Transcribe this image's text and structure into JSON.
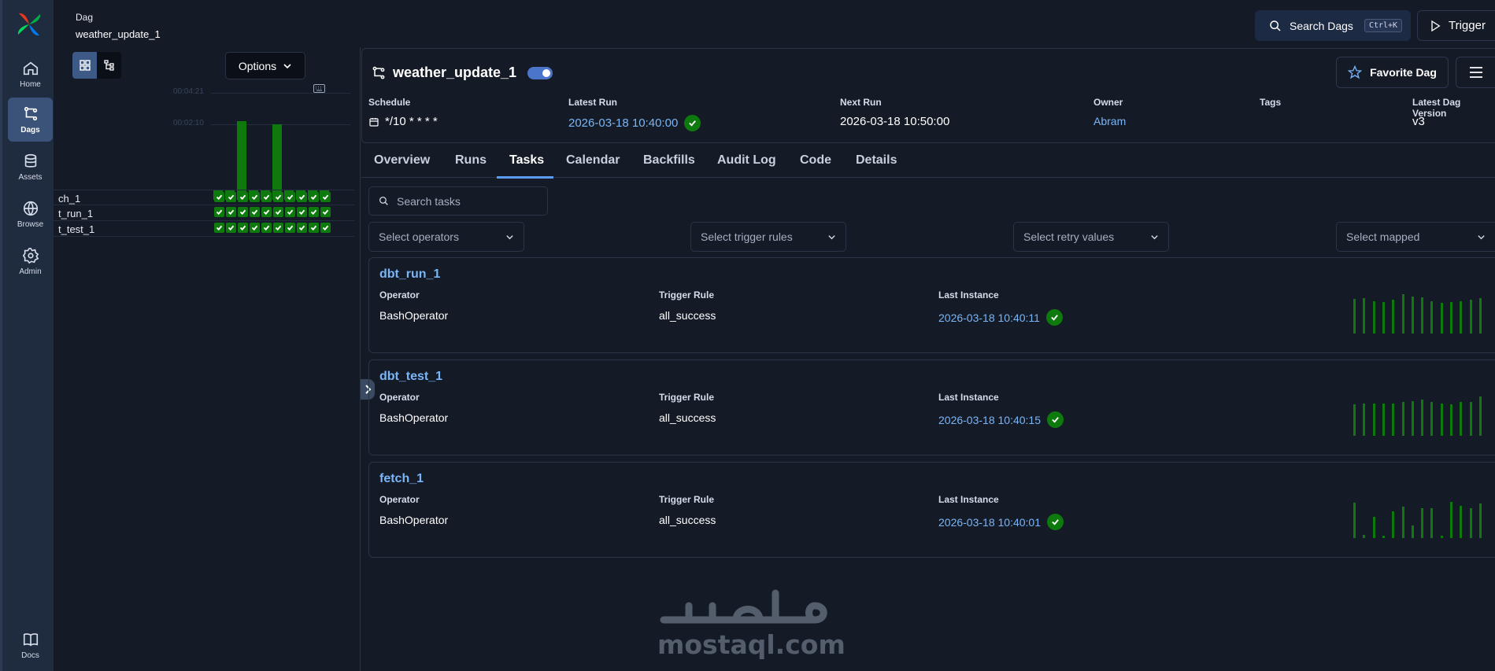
{
  "nav": {
    "items": [
      {
        "label": "Home",
        "icon": "home-icon"
      },
      {
        "label": "Dags",
        "icon": "dags-icon",
        "active": true
      },
      {
        "label": "Assets",
        "icon": "assets-icon"
      },
      {
        "label": "Browse",
        "icon": "browse-icon"
      },
      {
        "label": "Admin",
        "icon": "admin-icon"
      },
      {
        "label": "Docs",
        "icon": "docs-icon"
      }
    ]
  },
  "header": {
    "crumb_label": "Dag",
    "crumb_value": "weather_update_1",
    "search_label": "Search Dags",
    "search_shortcut": "Ctrl+K",
    "trigger_label": "Trigger"
  },
  "grid": {
    "options_label": "Options",
    "duration_ticks": [
      "00:04:21",
      "00:02:10"
    ],
    "run_durations_fraction": [
      0.12,
      0.12,
      1.0,
      0.12,
      0.12,
      0.96,
      0.12,
      0.12,
      0.12,
      0.12
    ],
    "tasks": [
      "fetch_1",
      "dbt_run_1",
      "dbt_test_1"
    ],
    "task_names_visible": [
      "ch_1",
      "t_run_1",
      "t_test_1"
    ],
    "runs_per_task": 10,
    "state": "success"
  },
  "dag": {
    "title": "weather_update_1",
    "paused": false,
    "favorite_label": "Favorite Dag",
    "meta": {
      "schedule_label": "Schedule",
      "schedule_value": "*/10 * * * *",
      "latest_run_label": "Latest Run",
      "latest_run_value": "2026-03-18 10:40:00",
      "next_run_label": "Next Run",
      "next_run_value": "2026-03-18 10:50:00",
      "owner_label": "Owner",
      "owner_value": "Abram",
      "tags_label": "Tags",
      "version_label": "Latest Dag Version",
      "version_value": "v3"
    }
  },
  "tabs": [
    "Overview",
    "Runs",
    "Tasks",
    "Calendar",
    "Backfills",
    "Audit Log",
    "Code",
    "Details"
  ],
  "active_tab": "Tasks",
  "filters": {
    "search_placeholder": "Search tasks",
    "operators": "Select operators",
    "trigger_rules": "Select trigger rules",
    "retry_values": "Select retry values",
    "mapped": "Select mapped"
  },
  "cards_labels": {
    "operator": "Operator",
    "trigger_rule": "Trigger Rule",
    "last_instance": "Last Instance"
  },
  "cards": [
    {
      "name": "dbt_run_1",
      "operator": "BashOperator",
      "trigger_rule": "all_success",
      "last_instance": "2026-03-18 10:40:11",
      "bars": [
        0.78,
        0.8,
        0.74,
        0.72,
        0.76,
        0.9,
        0.84,
        0.82,
        0.74,
        0.7,
        0.72,
        0.74,
        0.76,
        0.8
      ]
    },
    {
      "name": "dbt_test_1",
      "operator": "BashOperator",
      "trigger_rule": "all_success",
      "last_instance": "2026-03-18 10:40:15",
      "bars": [
        0.72,
        0.74,
        0.74,
        0.74,
        0.74,
        0.76,
        0.78,
        0.82,
        0.76,
        0.74,
        0.72,
        0.76,
        0.76,
        0.9
      ]
    },
    {
      "name": "fetch_1",
      "operator": "BashOperator",
      "trigger_rule": "all_success",
      "last_instance": "2026-03-18 10:40:01",
      "bars": [
        0.8,
        0.08,
        0.48,
        0.06,
        0.6,
        0.72,
        0.28,
        0.68,
        0.68,
        0.06,
        0.82,
        0.74,
        0.68,
        0.78
      ]
    }
  ],
  "watermark": "mostaql.com",
  "colors": {
    "success": "#0e7a0d",
    "link": "#7ab6f7",
    "accent": "#5b9cf0"
  }
}
